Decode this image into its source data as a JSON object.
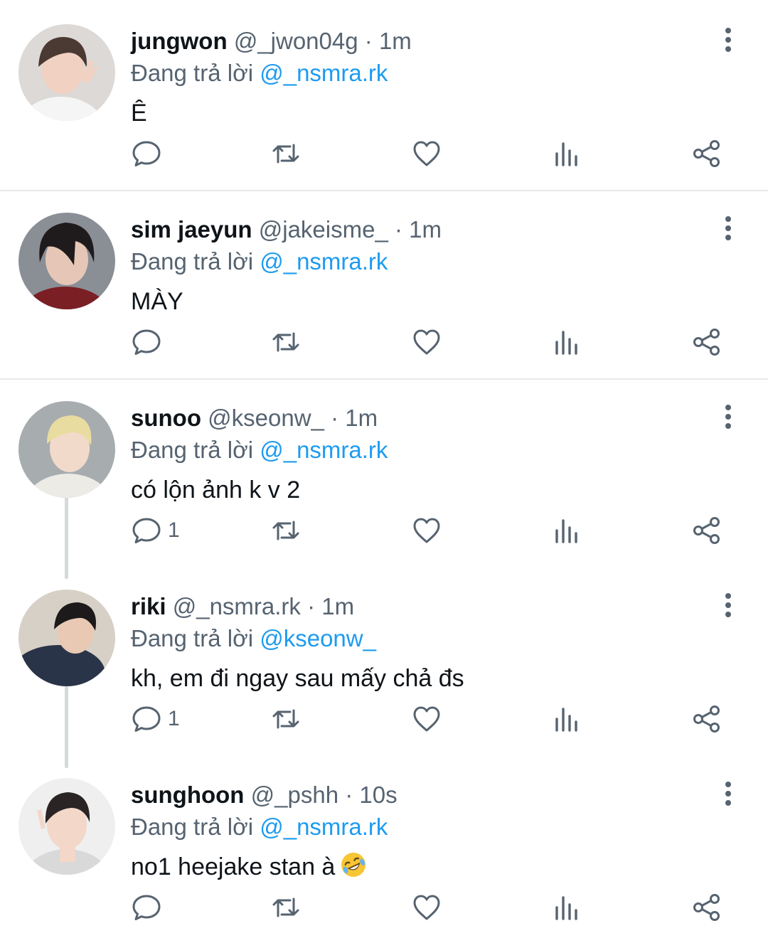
{
  "reply_prefix": "Đang trả lời",
  "tweets": [
    {
      "name": "jungwon",
      "handle": "@_jwon04g",
      "sep": "·",
      "time": "1m",
      "reply_to": "@_nsmra.rk",
      "text": "Ê",
      "reply_count": "",
      "avatar_colors": {
        "bg": "#dcd9d6",
        "hair": "#4a3a33",
        "skin": "#f1d2c2",
        "shirt": "#f5f5f5"
      }
    },
    {
      "name": "sim jaeyun",
      "handle": "@jakeisme_",
      "sep": "·",
      "time": "1m",
      "reply_to": "@_nsmra.rk",
      "text": "MÀY",
      "reply_count": "",
      "avatar_colors": {
        "bg": "#8a8f96",
        "hair": "#1f1b1c",
        "skin": "#e6c7b7",
        "shirt": "#7a1f24"
      }
    },
    {
      "name": "sunoo",
      "handle": "@kseonw_",
      "sep": "·",
      "time": "1m",
      "reply_to": "@_nsmra.rk",
      "text": "có lộn ảnh k v 2",
      "reply_count": "1",
      "avatar_colors": {
        "bg": "#a7acaf",
        "hair": "#e8dca0",
        "skin": "#f2dacb",
        "shirt": "#ecebe6"
      }
    },
    {
      "name": "riki",
      "handle": "@_nsmra.rk",
      "sep": "·",
      "time": "1m",
      "reply_to": "@kseonw_",
      "text": "kh, em đi ngay sau mấy chả đs",
      "reply_count": "1",
      "avatar_colors": {
        "bg": "#d6d0c6",
        "hair": "#1c1a1a",
        "skin": "#e9c9b4",
        "shirt": "#2a3448"
      }
    },
    {
      "name": "sunghoon",
      "handle": "@_pshh",
      "sep": "·",
      "time": "10s",
      "reply_to": "@_nsmra.rk",
      "text": "no1 heejake stan à",
      "emoji": "rolling-on-floor-laughing-emoji",
      "reply_count": "",
      "avatar_colors": {
        "bg": "#efefef",
        "hair": "#2a2424",
        "skin": "#f3d7c8",
        "shirt": "#d9d9d9"
      }
    }
  ],
  "icons": {
    "reply": "reply-icon",
    "retweet": "retweet-icon",
    "like": "like-icon",
    "views": "views-icon",
    "share": "share-icon",
    "more": "more-options-icon"
  },
  "colors": {
    "mention": "#1d9bf0",
    "secondary_text": "#566370",
    "primary_text": "#0f1419",
    "divider": "#e6e9ec"
  }
}
